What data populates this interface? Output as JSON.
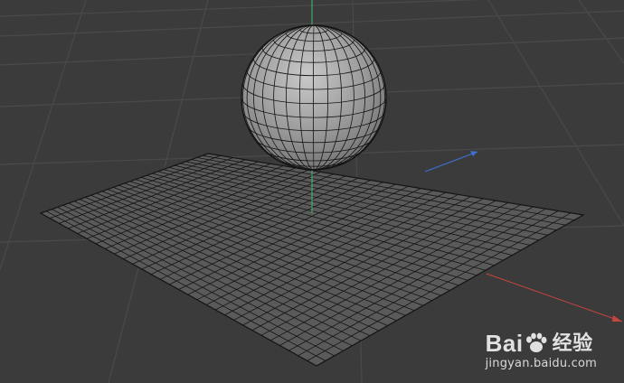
{
  "watermark": {
    "brand_prefix": "Bai",
    "brand_suffix": "经验",
    "url": "jingyan.baidu.com"
  },
  "colors": {
    "viewport_bg": "#3b3b3b",
    "grid_line": "#4a4a4a",
    "plane_fill": "#5a5a5a",
    "wire": "#141414",
    "axis_x": "#c8443f",
    "axis_y": "#3fbf6a",
    "axis_z": "#3f6fd0"
  },
  "scene": {
    "objects": [
      "sphere",
      "plane"
    ],
    "plane_segments": 30
  }
}
